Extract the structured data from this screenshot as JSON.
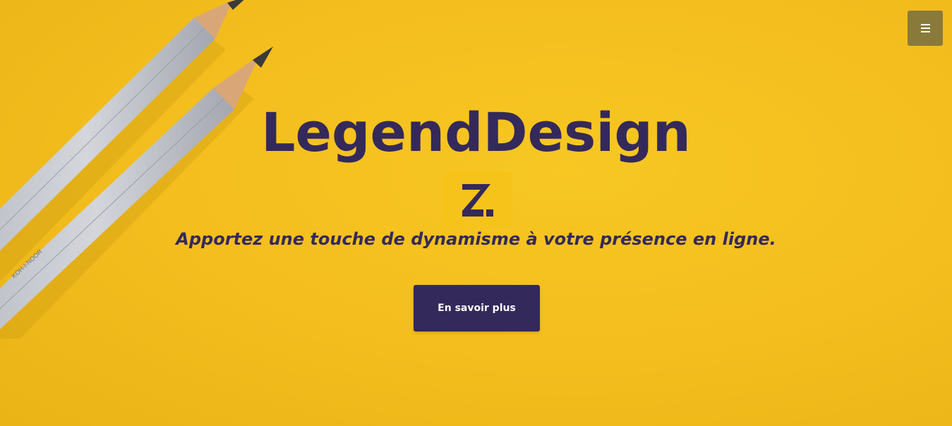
{
  "hero": {
    "title": "LegendDesign",
    "tagline": "Apportez une touche de dynamisme à votre présence en ligne.",
    "cta_label": "En savoir plus"
  },
  "nav": {
    "menu_icon": "hamburger-menu-icon"
  },
  "logo": {
    "icon": "legenddesign-logo-icon"
  },
  "colors": {
    "background": "#f3bd1e",
    "primary": "#34295b",
    "menu_button": "#8a7a3a",
    "logo_background": "#f6c31a"
  }
}
